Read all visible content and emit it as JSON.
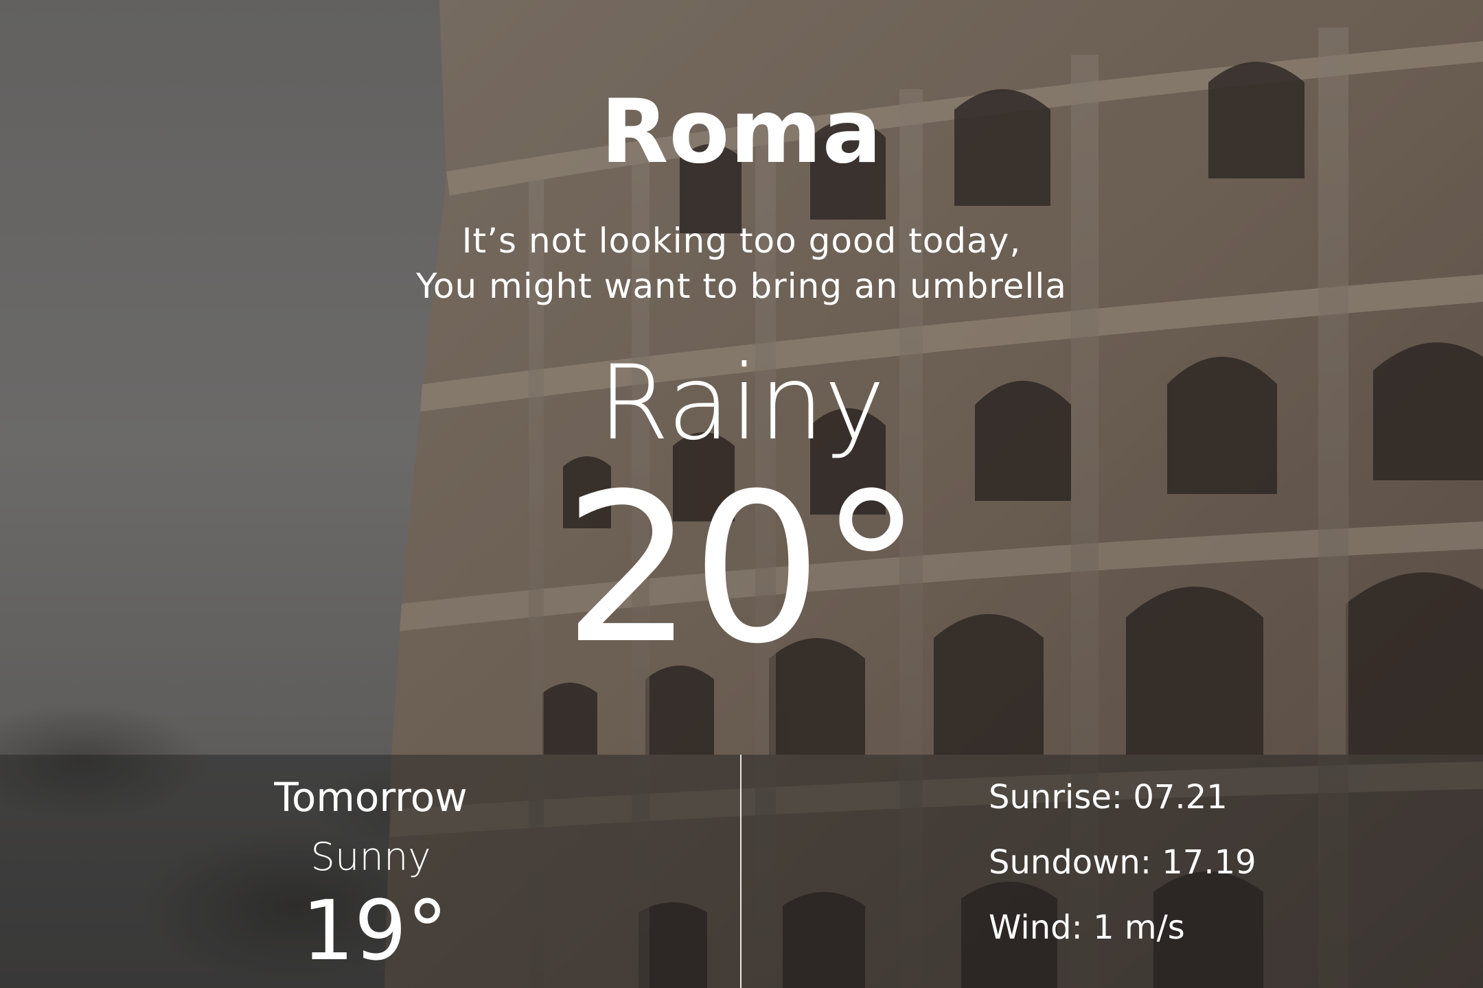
{
  "city": "Roma",
  "message": {
    "line1": "It’s not looking too good today,",
    "line2": "You might want to bring an umbrella"
  },
  "current": {
    "condition": "Rainy",
    "temperature": "20°"
  },
  "tomorrow": {
    "title": "Tomorrow",
    "condition": "Sunny",
    "temperature": "19°"
  },
  "details": {
    "sunrise": "Sunrise: 07.21",
    "sundown": "Sundown: 17.19",
    "wind": "Wind: 1 m/s"
  },
  "colors": {
    "text": "#ffffff",
    "panel": "rgba(30,30,30,0.45)",
    "divider": "#e8e8e8"
  }
}
